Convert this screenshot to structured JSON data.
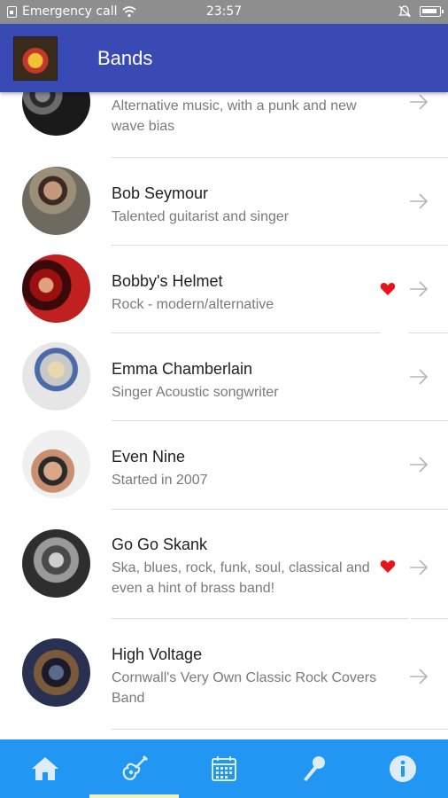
{
  "status_bar": {
    "carrier": "Emergency call",
    "time": "23:57"
  },
  "app_bar": {
    "title": "Bands",
    "logo_icon": "band-logo-icon"
  },
  "bands": [
    {
      "title": "",
      "subtitle": "Alternative music, with a punk and new wave bias",
      "favorite": false
    },
    {
      "title": "Bob Seymour",
      "subtitle": "Talented guitarist and singer",
      "favorite": false
    },
    {
      "title": "Bobby's Helmet",
      "subtitle": "Rock - modern/alternative",
      "favorite": true
    },
    {
      "title": "Emma Chamberlain",
      "subtitle": "Singer Acoustic songwriter",
      "favorite": false
    },
    {
      "title": "Even Nine",
      "subtitle": "Started in 2007",
      "favorite": false
    },
    {
      "title": "Go Go Skank",
      "subtitle": "Ska, blues, rock, funk, soul, classical and even a hint of brass band!",
      "favorite": true
    },
    {
      "title": "High Voltage",
      "subtitle": "Cornwall's Very Own Classic  Rock Covers Band",
      "favorite": false
    }
  ],
  "bottom_nav": {
    "items": [
      "home-icon",
      "guitar-icon",
      "calendar-icon",
      "microphone-icon",
      "info-icon"
    ],
    "active_index": 1
  },
  "colors": {
    "app_bar": "#3a4ab5",
    "bottom_nav": "#2196f3",
    "favorite_heart": "#e8141b",
    "active_indicator": "#f4f1b0"
  }
}
